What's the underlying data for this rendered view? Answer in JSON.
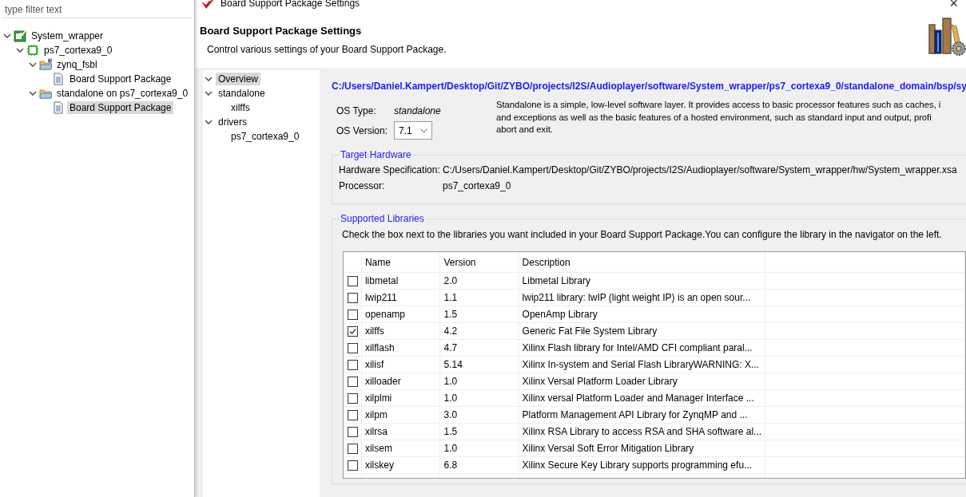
{
  "explorer": {
    "filter": {
      "placeholder": "type filter text"
    },
    "tree": [
      {
        "kind": "project",
        "label": "System_wrapper",
        "expanded": true,
        "selected": false,
        "children": [
          {
            "kind": "chip",
            "label": "ps7_cortexa9_0",
            "expanded": true,
            "selected": false,
            "children": [
              {
                "kind": "bfolder",
                "label": "zynq_fsbl",
                "expanded": true,
                "selected": false,
                "children": [
                  {
                    "kind": "document",
                    "label": "Board Support Package",
                    "selected": false
                  }
                ]
              },
              {
                "kind": "folder",
                "label": "standalone on ps7_cortexa9_0",
                "expanded": true,
                "selected": false,
                "children": [
                  {
                    "kind": "document",
                    "label": "Board Support Package",
                    "selected": true
                  }
                ]
              }
            ]
          }
        ]
      }
    ]
  },
  "dialog": {
    "title": "Board Support Package Settings",
    "close": "×",
    "header": {
      "title": "Board Support Package Settings",
      "subtitle": "Control various settings of your Board Support Package."
    },
    "nav": [
      {
        "label": "Overview",
        "expanded": true,
        "selected": true
      },
      {
        "label": "standalone",
        "expanded": true,
        "selected": false,
        "children": [
          {
            "label": "xilffs",
            "selected": false
          }
        ]
      },
      {
        "label": "drivers",
        "expanded": true,
        "selected": false,
        "children": [
          {
            "label": "ps7_cortexa9_0",
            "selected": false
          }
        ]
      }
    ],
    "overview": {
      "path": "C:/Users/Daniel.Kampert/Desktop/Git/ZYBO/projects/I2S/Audioplayer/software/System_wrapper/ps7_cortexa9_0/standalone_domain/bsp/sy",
      "os_type_label": "OS Type:",
      "os_type": "standalone",
      "os_version_label": "OS Version:",
      "os_version": "7.1",
      "description": [
        "Standalone is a simple, low-level software layer. It provides access to basic processor features such as caches, i",
        "and exceptions as well as the basic features of a hosted environment, such as standard input and output, profi",
        "abort and exit."
      ],
      "target_hardware": {
        "legend": "Target Hardware",
        "rows": [
          {
            "label": "Hardware Specification:",
            "value": "C:/Users/Daniel.Kampert/Desktop/Git/ZYBO/projects/I2S/Audioplayer/software/System_wrapper/hw/System_wrapper.xsa"
          },
          {
            "label": "Processor:",
            "value": "ps7_cortexa9_0"
          }
        ]
      },
      "libraries": {
        "legend": "Supported Libraries",
        "instruction": "Check the box next to the libraries you want included in your Board Support Package.You can configure the library in the navigator on the left.",
        "columns": [
          "Name",
          "Version",
          "Description"
        ],
        "rows": [
          {
            "checked": false,
            "name": "libmetal",
            "version": "2.0",
            "description": "Libmetal Library"
          },
          {
            "checked": false,
            "name": "lwip211",
            "version": "1.1",
            "description": "lwip211 library: lwIP (light weight IP) is an open sour..."
          },
          {
            "checked": false,
            "name": "openamp",
            "version": "1.5",
            "description": "OpenAmp Library"
          },
          {
            "checked": true,
            "name": "xilffs",
            "version": "4.2",
            "description": "Generic Fat File System Library"
          },
          {
            "checked": false,
            "name": "xilflash",
            "version": "4.7",
            "description": "Xilinx Flash library for Intel/AMD CFI compliant paral..."
          },
          {
            "checked": false,
            "name": "xilisf",
            "version": "5.14",
            "description": "Xilinx In-system and Serial Flash LibraryWARNING: X..."
          },
          {
            "checked": false,
            "name": "xilloader",
            "version": "1.0",
            "description": "Xilinx Versal Platform Loader Library"
          },
          {
            "checked": false,
            "name": "xilplmi",
            "version": "1.0",
            "description": "Xilinx versal Platform Loader and Manager Interface ..."
          },
          {
            "checked": false,
            "name": "xilpm",
            "version": "3.0",
            "description": "Platform Management API Library for ZynqMP and ..."
          },
          {
            "checked": false,
            "name": "xilrsa",
            "version": "1.5",
            "description": "Xilinx RSA Library to access RSA and SHA software al..."
          },
          {
            "checked": false,
            "name": "xilsem",
            "version": "1.0",
            "description": "Xilinx Versal Soft Error Mitigation Library"
          },
          {
            "checked": false,
            "name": "xilskey",
            "version": "6.8",
            "description": "Xilinx Secure Key Library supports programming efu..."
          }
        ]
      }
    }
  }
}
